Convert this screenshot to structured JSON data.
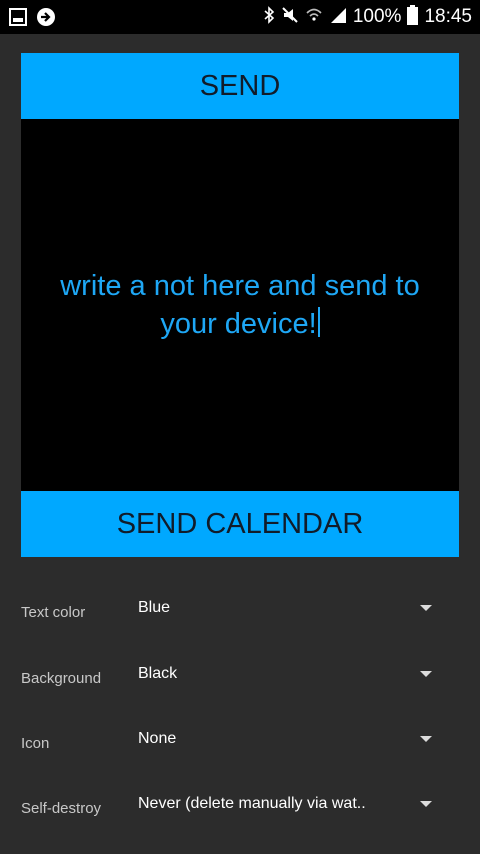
{
  "status_bar": {
    "battery": "100%",
    "time": "18:45",
    "icons": [
      "image-icon",
      "sync-icon",
      "bluetooth-icon",
      "mute-icon",
      "wifi-icon",
      "signal-icon",
      "battery-icon"
    ]
  },
  "main": {
    "send_label": "SEND",
    "note_text": "write a not here and send to your device!",
    "send_calendar_label": "SEND CALENDAR",
    "colors": {
      "accent": "#00a8ff",
      "note_text": "#1ea7f5",
      "card_bg": "#000000",
      "page_bg": "#2c2c2c"
    }
  },
  "settings": [
    {
      "label": "Text color",
      "value": "Blue"
    },
    {
      "label": "Background",
      "value": "Black"
    },
    {
      "label": "Icon",
      "value": "None"
    },
    {
      "label": "Self-destroy",
      "value": "Never (delete manually via wat.."
    }
  ]
}
